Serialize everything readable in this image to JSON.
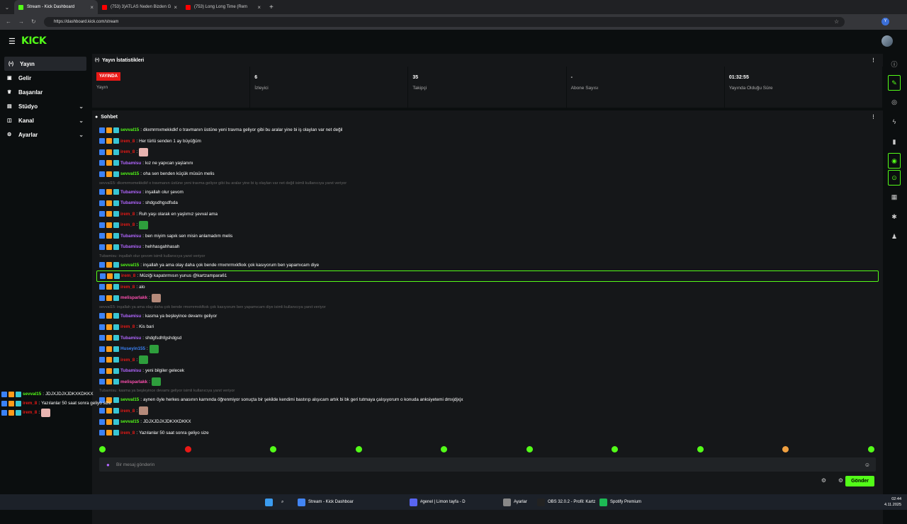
{
  "browser": {
    "tabs": [
      {
        "title": "Stream - Kick Dashboard",
        "color": "#53fc18"
      },
      {
        "title": "(753) 3)ATLAS Neden Bizden G",
        "color": "#ff0000"
      },
      {
        "title": "(753) Long Long Time (Rem",
        "color": "#ff0000"
      }
    ],
    "url": "https://dashboard.kick.com/stream"
  },
  "header": {
    "logo": "KICK"
  },
  "sidebar": {
    "items": [
      {
        "label": "Yayın",
        "icon": "broadcast-icon",
        "glyph": "(•)"
      },
      {
        "label": "Gelir",
        "icon": "money-icon",
        "glyph": "▣"
      },
      {
        "label": "Başarılar",
        "icon": "trophy-icon",
        "glyph": "♛"
      },
      {
        "label": "Stüdyo",
        "icon": "studio-icon",
        "glyph": "▤"
      },
      {
        "label": "Kanal",
        "icon": "channel-icon",
        "glyph": "◫"
      },
      {
        "label": "Ayarlar",
        "icon": "gear-icon",
        "glyph": "⚙"
      }
    ]
  },
  "stats": {
    "title": "Yayın İstatistikleri",
    "badge": "YAYINDA",
    "items": [
      {
        "value": "",
        "label": "Yayın"
      },
      {
        "value": "6",
        "label": "İzleyici"
      },
      {
        "value": "35",
        "label": "Takipçi"
      },
      {
        "value": "-",
        "label": "Abone Sayısı"
      },
      {
        "value": "01:32:55",
        "label": "Yayında Olduğu Süre"
      }
    ]
  },
  "chat": {
    "title": "Sohbet",
    "placeholder": "Bir mesaj gönderin",
    "send": "Gönder",
    "messages": [
      {
        "type": "msg",
        "user": "sevval15",
        "color": "#53fc18",
        "text": "dkxmrmxmekkdkf o travmanın üstüne yeni travma geliyor gibi bu aralar yine bi iş olaylan var net değil"
      },
      {
        "type": "msg",
        "user": "irem_8",
        "color": "#e91916",
        "text": "Her türlü senden 1 ay büyüğüm"
      },
      {
        "type": "msg",
        "user": "irem_8",
        "color": "#e91916",
        "text": "",
        "emote": "#e8b4b0"
      },
      {
        "type": "msg",
        "user": "Tubamisu",
        "color": "#b266ff",
        "text": "kız ne yapıcan yaşlanını"
      },
      {
        "type": "msg",
        "user": "sevval15",
        "color": "#53fc18",
        "text": "oha sen benden küçük müsün melis"
      },
      {
        "type": "reply",
        "text": "sevval15: dkxmrmxmekkdkf o travmanın üstüne yeni travma geliyor gibi bu aralar yine bi iş olaylan var net değil isimli kullanıcıya yanıt veriyor"
      },
      {
        "type": "msg",
        "user": "Tubamisu",
        "color": "#b266ff",
        "text": "inşallah olur şevom"
      },
      {
        "type": "msg",
        "user": "Tubamisu",
        "color": "#b266ff",
        "text": "shdgsdhgsdfsda"
      },
      {
        "type": "msg",
        "user": "irem_8",
        "color": "#e91916",
        "text": "Ruh yaşı olarak en yaşlımız şevval ama"
      },
      {
        "type": "msg",
        "user": "irem_8",
        "color": "#e91916",
        "text": "",
        "emote": "#2e9e3c"
      },
      {
        "type": "msg",
        "user": "Tubamisu",
        "color": "#b266ff",
        "text": "ben miyim sapık sen misin anlamadım melis"
      },
      {
        "type": "msg",
        "user": "Tubamisu",
        "color": "#b266ff",
        "text": "hehhasgahhasah"
      },
      {
        "type": "reply",
        "text": "Tubamisu: inşallah olur şevom isimli kullanıcıya yanıt veriyor"
      },
      {
        "type": "msg",
        "user": "sevval15",
        "color": "#53fc18",
        "text": "inşallah ya ama olay daha çok bende rmxmrmxkfkxk çok kasıyorum ben yapamıcam diye"
      },
      {
        "type": "msg",
        "user": "irem_8",
        "color": "#e91916",
        "text": "Müziği kapatırmısın yunus @kartzampara61",
        "highlight": true
      },
      {
        "type": "msg",
        "user": "irem_8",
        "color": "#e91916",
        "text": "alo"
      },
      {
        "type": "msg",
        "user": "melisparlakk",
        "color": "#ff4fb0",
        "text": "",
        "emote": "#b58a7a"
      },
      {
        "type": "reply",
        "text": "sevval15: inşallah ya ama olay daha çok bende rmxmrmxkfkxk çok kasıyorum ben yapamıcam diye isimli kullanıcıya yanıt veriyor"
      },
      {
        "type": "msg",
        "user": "Tubamisu",
        "color": "#b266ff",
        "text": "kasma ya beşleyince devamı geliyor"
      },
      {
        "type": "msg",
        "user": "irem_8",
        "color": "#e91916",
        "text": "Kis bari"
      },
      {
        "type": "msg",
        "user": "Tubamisu",
        "color": "#b266ff",
        "text": "shdgfsdhfgshdgsd"
      },
      {
        "type": "msg",
        "user": "Huseyin155",
        "color": "#3b82f6",
        "text": "",
        "emote": "#2e9e3c"
      },
      {
        "type": "msg",
        "user": "irem_8",
        "color": "#e91916",
        "text": "",
        "emote": "#2e9e3c"
      },
      {
        "type": "msg",
        "user": "Tubamisu",
        "color": "#b266ff",
        "text": "yeni bilgiler gelecek"
      },
      {
        "type": "msg",
        "user": "melisparlakk",
        "color": "#ff4fb0",
        "text": "",
        "emote": "#2e9e3c"
      },
      {
        "type": "reply",
        "text": "Tubamisu: kasma ya beşleyince devamı geliyor isimli kullanıcıya yanıt veriyor"
      },
      {
        "type": "msg",
        "user": "sevval15",
        "color": "#53fc18",
        "text": "aynen öyle herkes anasının karnında öğrenmiyor sonuçta bir şekilde kendimi bastırıp alışıcam artık bi bk geri tutmaya çalışıyorum o konuda anksiyetemi dmxjdjxjx"
      },
      {
        "type": "msg",
        "user": "irem_8",
        "color": "#e91916",
        "text": "",
        "emote": "#b58a7a"
      },
      {
        "type": "msg",
        "user": "sevval15",
        "color": "#53fc18",
        "text": "JDJXJDJXJDKXKDKKX"
      },
      {
        "type": "msg",
        "user": "irem_8",
        "color": "#e91916",
        "text": "Yazılanlar 50 saat sonra geliyo size"
      },
      {
        "type": "msg",
        "user": "irem_8",
        "color": "#e91916",
        "text": "",
        "emote": "#e8b4b0"
      }
    ]
  },
  "overlay": [
    {
      "user": "sevval15",
      "color": "#53fc18",
      "text": "JDJXJDJXJDKXKDKKX"
    },
    {
      "user": "irem_8",
      "color": "#e91916",
      "text": "Yazılanlar 50 saat sonra geliyo size"
    },
    {
      "user": "irem_8",
      "color": "#e91916",
      "text": "",
      "emote": "#e8b4b0"
    }
  ],
  "taskbar": {
    "items": [
      {
        "label": "Stream - Kick Dashboar",
        "color": "#4285f4"
      },
      {
        "label": "#genel | Limon tayfa - D",
        "color": "#5865f2"
      },
      {
        "label": "Ayarlar",
        "color": "#888"
      },
      {
        "label": "OBS 32.0.2 - Profil: Kartz",
        "color": "#222"
      },
      {
        "label": "Spotify Premium",
        "color": "#1db954"
      }
    ],
    "time": "02:44",
    "date": "4.11.2025"
  }
}
